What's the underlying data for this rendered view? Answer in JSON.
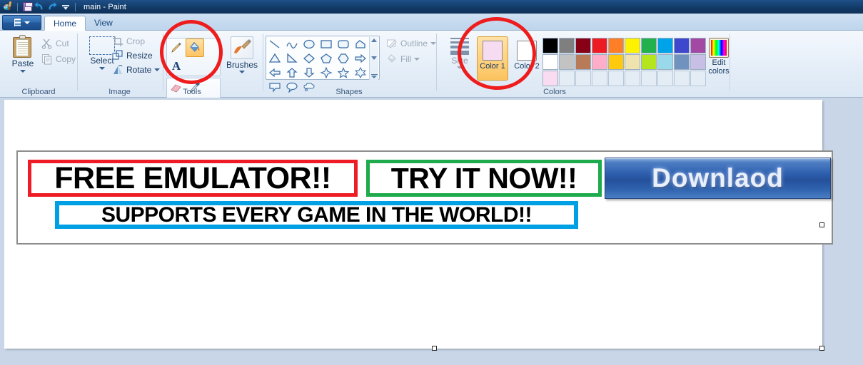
{
  "window": {
    "title": "main - Paint",
    "quick_access": [
      {
        "name": "paint-app-icon",
        "label": "Paint"
      },
      {
        "name": "save-icon",
        "label": "Save"
      },
      {
        "name": "undo-icon",
        "label": "Undo"
      },
      {
        "name": "redo-icon",
        "label": "Redo"
      },
      {
        "name": "customize-quick-access-icon",
        "label": "Customize Quick Access Toolbar"
      }
    ]
  },
  "tabs": {
    "app_menu_label": "File",
    "items": [
      {
        "label": "Home",
        "active": true
      },
      {
        "label": "View",
        "active": false
      }
    ]
  },
  "ribbon": {
    "groups": [
      {
        "name": "clipboard",
        "label": "Clipboard",
        "paste_label": "Paste",
        "cut_label": "Cut",
        "copy_label": "Copy"
      },
      {
        "name": "image",
        "label": "Image",
        "select_label": "Select",
        "crop_label": "Crop",
        "resize_label": "Resize",
        "rotate_label": "Rotate"
      },
      {
        "name": "tools",
        "label": "Tools",
        "tools": [
          {
            "name": "pencil-tool",
            "selected": false
          },
          {
            "name": "fill-with-color-tool",
            "selected": true
          },
          {
            "name": "text-tool",
            "selected": false,
            "glyph": "A"
          },
          {
            "name": "eraser-tool",
            "selected": false
          },
          {
            "name": "color-picker-tool",
            "selected": false
          },
          {
            "name": "magnifier-tool",
            "selected": false
          }
        ]
      },
      {
        "name": "brushes",
        "label": "",
        "brushes_label": "Brushes"
      },
      {
        "name": "shapes",
        "label": "Shapes",
        "outline_label": "Outline",
        "fill_label": "Fill",
        "shape_names": [
          "line-shape",
          "curve-shape",
          "oval-shape",
          "rectangle-shape",
          "rounded-rectangle-shape",
          "polygon-shape",
          "triangle-shape",
          "right-triangle-shape",
          "diamond-shape",
          "pentagon-shape",
          "hexagon-shape",
          "right-arrow-shape",
          "left-arrow-shape",
          "up-arrow-shape",
          "down-arrow-shape",
          "four-point-star-shape",
          "five-point-star-shape",
          "six-point-star-shape",
          "rounded-callout-shape",
          "oval-callout-shape",
          "cloud-callout-shape"
        ]
      },
      {
        "name": "colors",
        "label": "Colors",
        "size_label": "Size",
        "color1_label": "Color 1",
        "color1_value": "#f6dcf0",
        "color2_label": "Color 2",
        "color2_value": "#ffffff",
        "edit_colors_label": "Edit colors",
        "palette_row1": [
          "#000000",
          "#7f7f7f",
          "#880015",
          "#ed1c24",
          "#ff7f27",
          "#fff200",
          "#22b14c",
          "#00a2e8",
          "#3f48cc",
          "#a349a4"
        ],
        "palette_row2": [
          "#ffffff",
          "#c3c3c3",
          "#b97a57",
          "#ffaec9",
          "#ffc90e",
          "#efe4b0",
          "#b5e61d",
          "#99d9ea",
          "#7092be",
          "#c8bfe7"
        ],
        "palette_row3": [
          "#fadcf2",
          "",
          "",
          "",
          "",
          "",
          "",
          "",
          "",
          ""
        ]
      }
    ]
  },
  "canvas": {
    "banners": [
      {
        "name": "banner-free-emulator",
        "text": "FREE EMULATOR!!",
        "border_color": "#ee1c25"
      },
      {
        "name": "banner-try-it-now",
        "text": "TRY IT NOW!!",
        "border_color": "#1eaa4d"
      },
      {
        "name": "banner-supports-every-game",
        "text": "SUPPORTS EVERY GAME IN THE WORLD!!",
        "border_color": "#00a0e4"
      }
    ],
    "download_button_text": "Downlaod"
  },
  "annotations": [
    {
      "name": "annotation-circle-tools",
      "color": "#ee1c1c"
    },
    {
      "name": "annotation-circle-colors",
      "color": "#ee1c1c"
    }
  ]
}
